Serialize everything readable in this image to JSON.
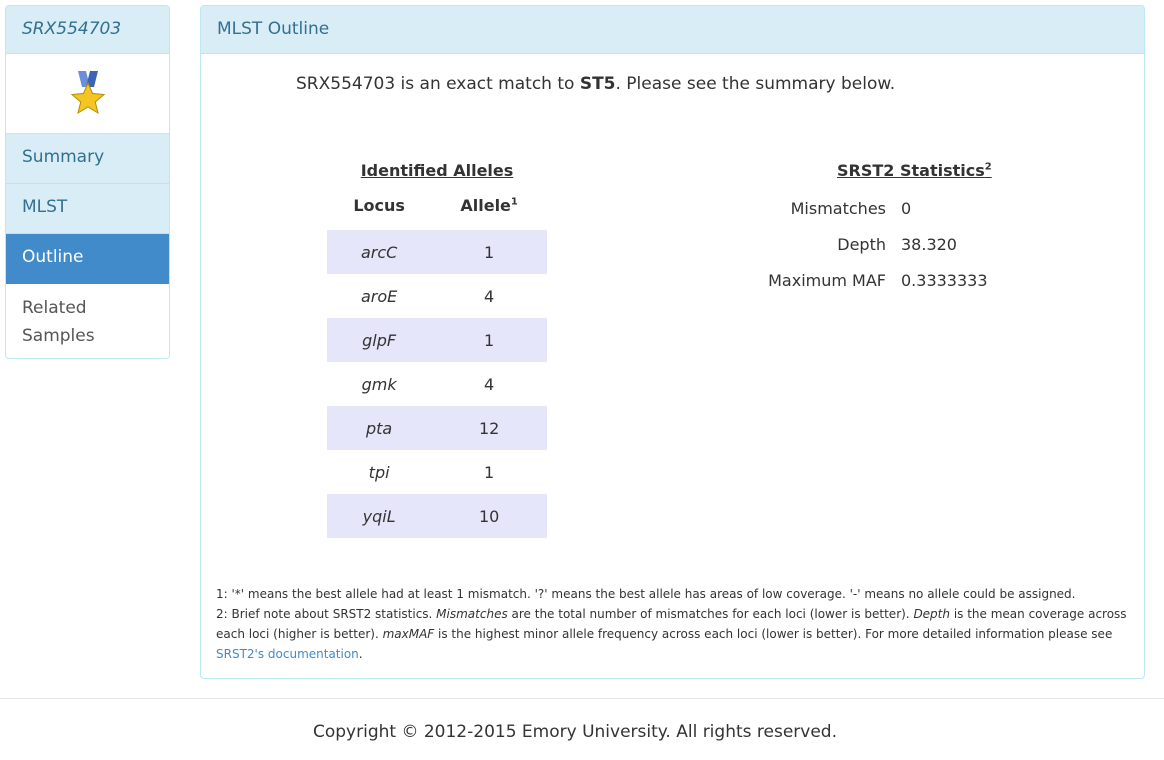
{
  "sidebar": {
    "title": "SRX554703",
    "medal_icon": "medal-star-icon",
    "items": [
      {
        "label": "Summary"
      },
      {
        "label": "MLST"
      },
      {
        "label": "Outline"
      },
      {
        "label": "Related Samples"
      }
    ]
  },
  "panel": {
    "heading": "MLST Outline",
    "intro_prefix": "SRX554703 is an exact match to ",
    "intro_st": "ST5",
    "intro_suffix": ". Please see the summary below."
  },
  "alleles": {
    "title": "Identified Alleles",
    "col_locus": "Locus",
    "col_allele": "Allele",
    "col_allele_sup": "1",
    "rows": [
      {
        "locus": "arcC",
        "allele": "1"
      },
      {
        "locus": "aroE",
        "allele": "4"
      },
      {
        "locus": "glpF",
        "allele": "1"
      },
      {
        "locus": "gmk",
        "allele": "4"
      },
      {
        "locus": "pta",
        "allele": "12"
      },
      {
        "locus": "tpi",
        "allele": "1"
      },
      {
        "locus": "yqiL",
        "allele": "10"
      }
    ]
  },
  "srst2": {
    "title": "SRST2 Statistics",
    "title_sup": "2",
    "stats": [
      {
        "label": "Mismatches",
        "value": "0"
      },
      {
        "label": "Depth",
        "value": "38.320"
      },
      {
        "label": "Maximum MAF",
        "value": "0.3333333"
      }
    ]
  },
  "notes": {
    "note1": "1: '*' means the best allele had at least 1 mismatch. '?' means the best allele has areas of low coverage. '-' means no allele could be assigned.",
    "note2_a": "2: Brief note about SRST2 statistics. ",
    "note2_mismatches": "Mismatches",
    "note2_b": " are the total number of mismatches for each loci (lower is better). ",
    "note2_depth": "Depth",
    "note2_c": " is the mean coverage across each loci (higher is better). ",
    "note2_maxmaf": "maxMAF",
    "note2_d": " is the highest minor allele frequency across each loci (lower is better). For more detailed information please see ",
    "note2_link": "SRST2's documentation",
    "note2_e": "."
  },
  "footer": {
    "copyright": "Copyright © 2012-2015 Emory University. All rights reserved."
  }
}
